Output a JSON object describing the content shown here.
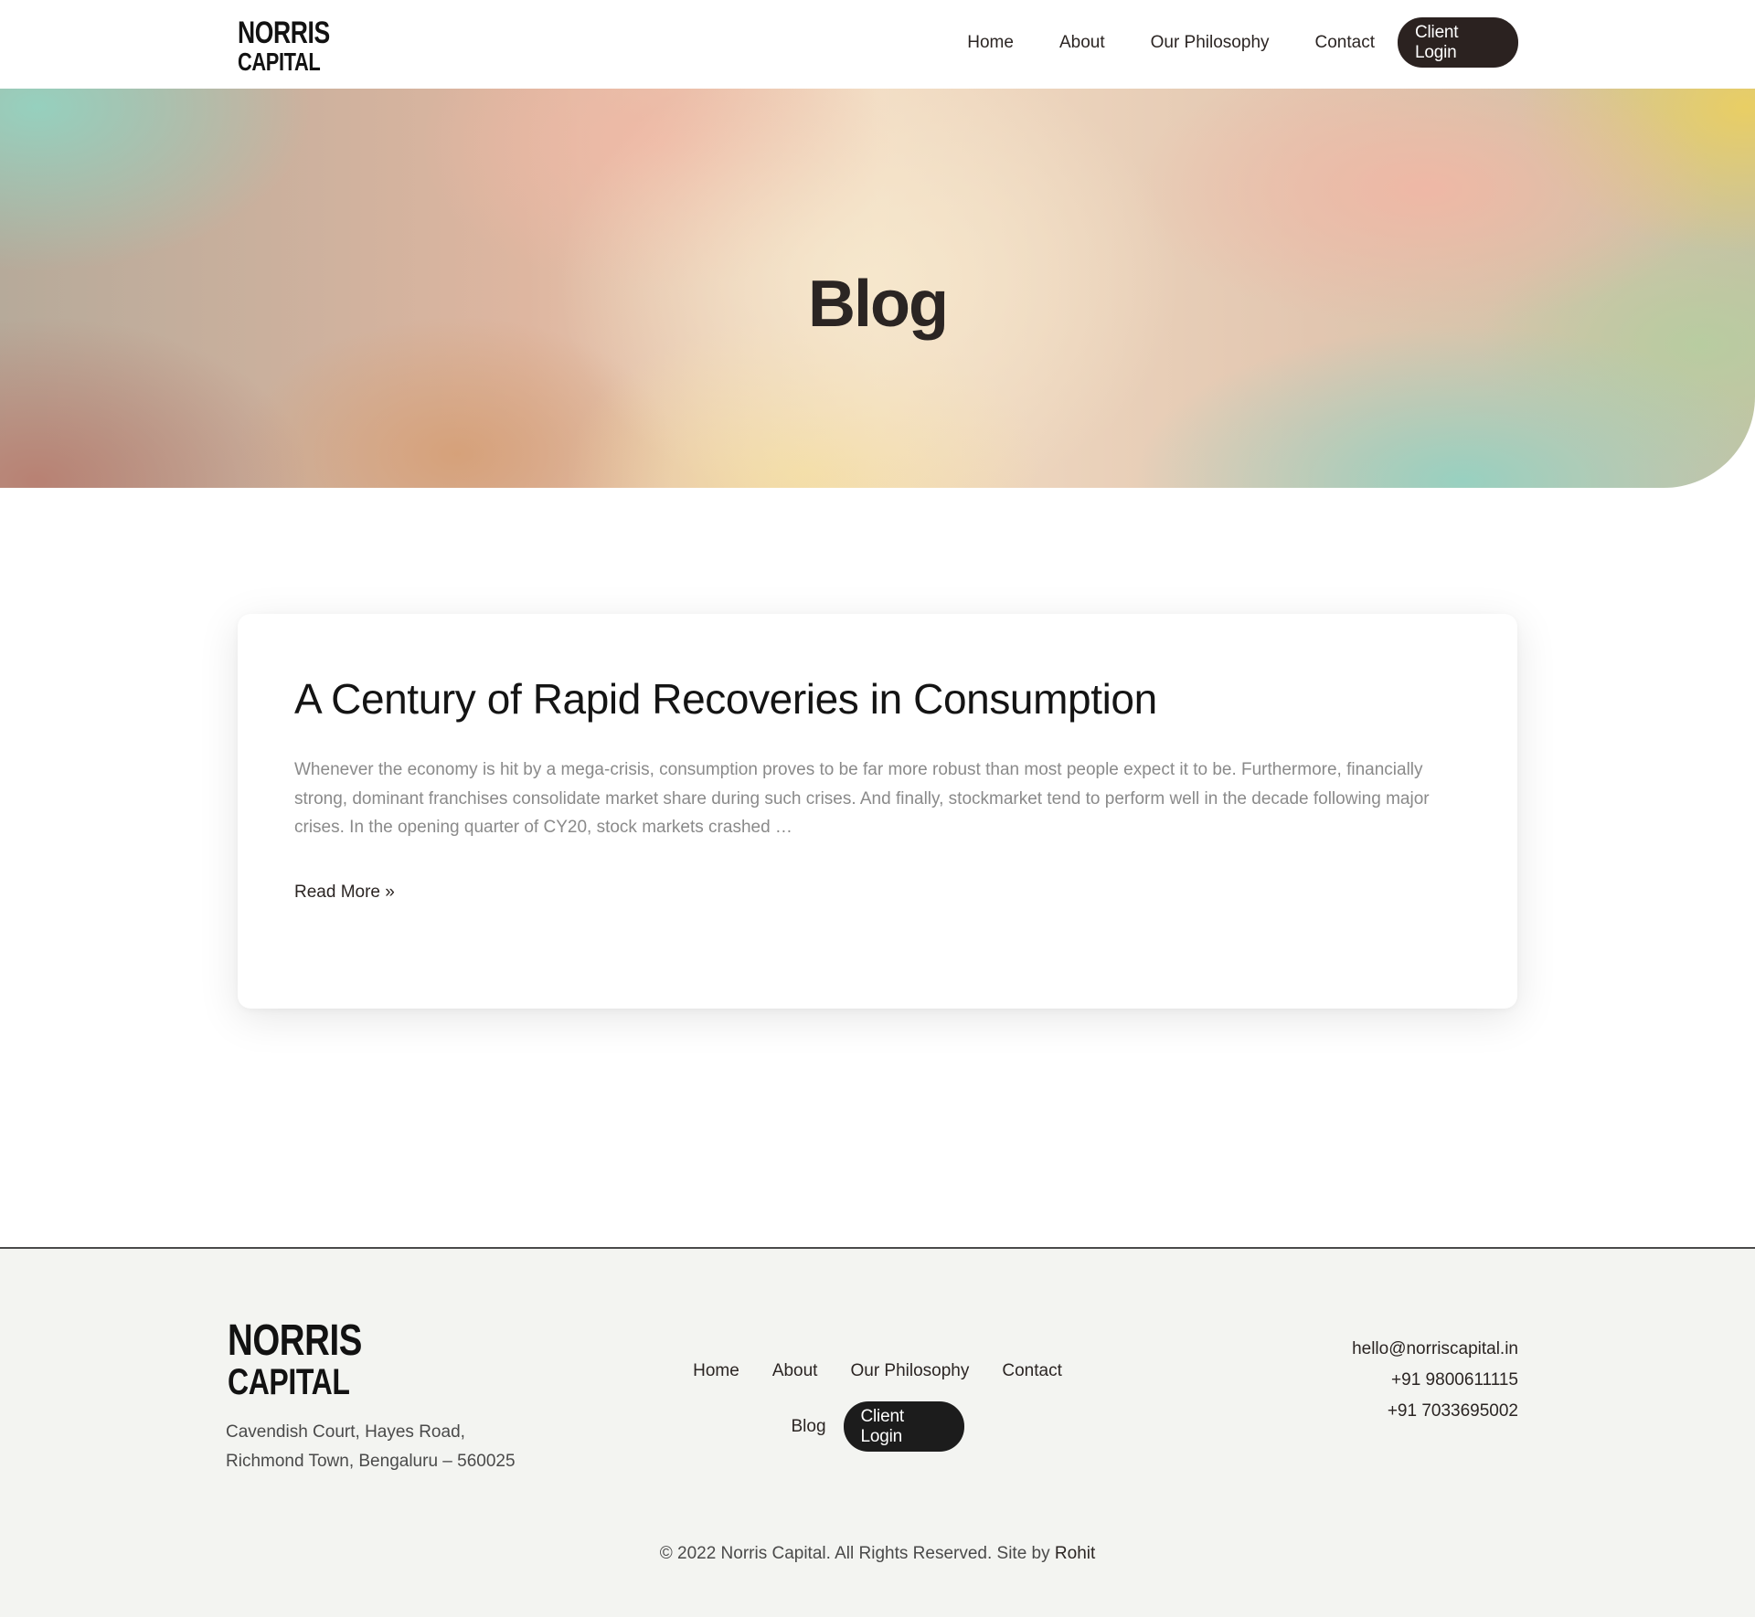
{
  "header": {
    "logo_line1": "NORRIS",
    "logo_line2": "CAPITAL",
    "nav": [
      "Home",
      "About",
      "Our Philosophy",
      "Contact"
    ],
    "client_login": "Client Login"
  },
  "hero": {
    "title": "Blog"
  },
  "post": {
    "title": "A Century of Rapid Recoveries in Consumption",
    "excerpt": "Whenever the economy is hit by a mega-crisis, consumption proves to be far more robust than most people expect it to be. Furthermore, financially strong, dominant franchises consolidate market share during such crises. And finally, stockmarket tend to perform well in the decade following major crises. In the opening quarter of CY20, stock markets crashed …",
    "read_more": "Read More »"
  },
  "footer": {
    "logo_line1": "NORRIS",
    "logo_line2": "CAPITAL",
    "address_line1": "Cavendish Court, Hayes Road,",
    "address_line2": "Richmond Town, Bengaluru – 560025",
    "nav": [
      "Home",
      "About",
      "Our Philosophy",
      "Contact",
      "Blog"
    ],
    "client_login": "Client Login",
    "email": "hello@norriscapital.in",
    "phone1": "+91 9800611115",
    "phone2": "+91 7033695002",
    "copyright": "© 2022 Norris Capital. All Rights Reserved. Site by",
    "credit": "Rohit"
  },
  "colors": {
    "dark_button": "#2b2220",
    "footer_bg": "#f3f4f1",
    "text_dark": "#2b2523",
    "excerpt_gray": "#8a8a8a"
  }
}
